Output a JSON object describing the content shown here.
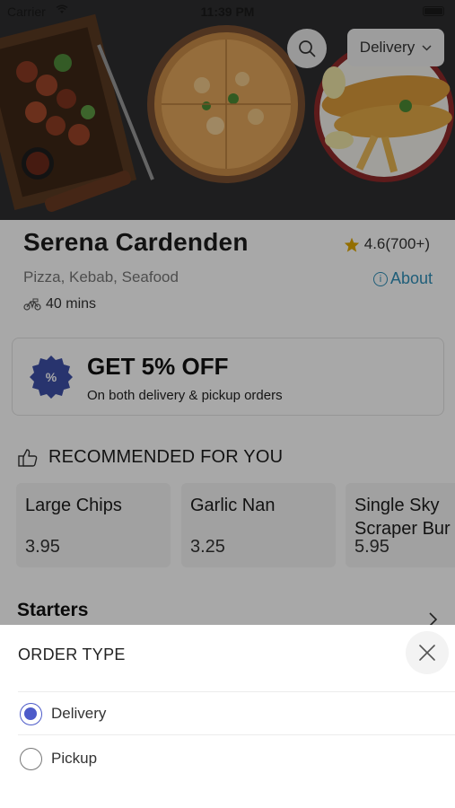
{
  "status_bar": {
    "carrier": "Carrier",
    "time": "11:39 PM"
  },
  "header": {
    "order_type_button": "Delivery"
  },
  "restaurant": {
    "name": "Serena Cardenden",
    "rating": "4.6(700+)",
    "cuisine": "Pizza, Kebab, Seafood",
    "about_label": "About",
    "delivery_time": "40 mins"
  },
  "offer": {
    "title": "GET 5% OFF",
    "subtitle": "On both delivery & pickup orders",
    "badge_symbol": "%"
  },
  "recommended": {
    "heading": "RECOMMENDED FOR YOU",
    "items": [
      {
        "name": "Large Chips",
        "price": "3.95"
      },
      {
        "name": "Garlic Nan",
        "price": "3.25"
      },
      {
        "name": "Single Sky\nScraper Bur",
        "price": "5.95"
      }
    ]
  },
  "section": {
    "title": "Starters"
  },
  "order_sheet": {
    "title": "ORDER TYPE",
    "options": [
      {
        "label": "Delivery",
        "selected": true
      },
      {
        "label": "Pickup",
        "selected": false
      }
    ]
  },
  "colors": {
    "accent": "#4d5bc9",
    "link": "#2f8fb8",
    "star": "#e0a800",
    "badge": "#3d4fa8",
    "scrim": "#000000"
  },
  "icons": [
    "search-icon",
    "chevron-down-icon",
    "star-icon",
    "info-icon",
    "delivery-bike-icon",
    "discount-badge-icon",
    "thumbs-up-icon",
    "chevron-right-icon",
    "close-icon"
  ]
}
